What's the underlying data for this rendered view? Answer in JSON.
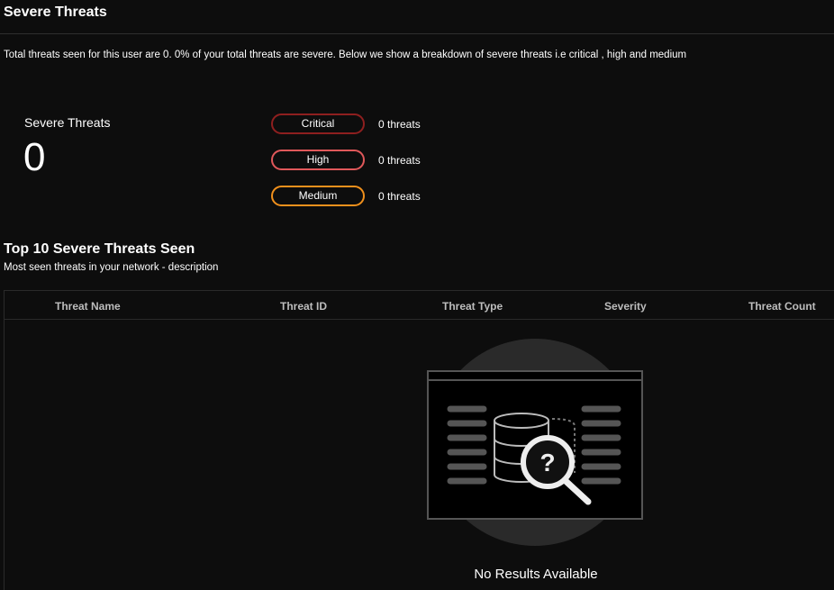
{
  "header": {
    "title": "Severe Threats"
  },
  "description": "Total threats seen for this user are 0. 0% of your total threats are severe. Below we show a breakdown of severe threats i.e critical , high and medium",
  "summary": {
    "label": "Severe Threats",
    "count": "0"
  },
  "breakdown": [
    {
      "label": "Critical",
      "count": "0 threats",
      "color": "#8e1f1f"
    },
    {
      "label": "High",
      "count": "0 threats",
      "color": "#e0585a"
    },
    {
      "label": "Medium",
      "count": "0 threats",
      "color": "#f0901c"
    }
  ],
  "top": {
    "title": "Top 10 Severe Threats Seen",
    "subtitle": "Most seen threats in your network - description"
  },
  "table": {
    "columns": [
      "Threat Name",
      "Threat ID",
      "Threat Type",
      "Severity",
      "Threat Count"
    ],
    "empty_text": "No Results Available"
  }
}
